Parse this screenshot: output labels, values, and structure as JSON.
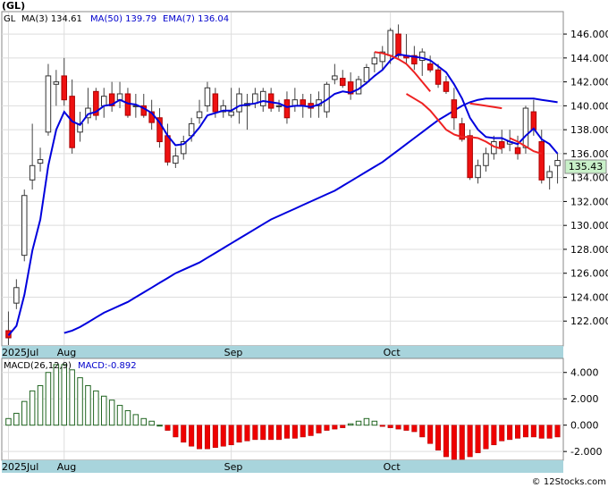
{
  "header": {
    "ticker": "(GL)",
    "credit": "© 12Stocks.com"
  },
  "legend": {
    "symbol": "GL",
    "items": [
      {
        "label": "MA(3)",
        "value": "134.61",
        "color": "#000000"
      },
      {
        "label": "MA(50)",
        "value": "139.79",
        "color": "#0000cc"
      },
      {
        "label": "EMA(7)",
        "value": "136.04",
        "color": "#0000cc"
      }
    ]
  },
  "macd_legend": {
    "params": "MACD(26,12,9)",
    "value": "MACD:-0.892"
  },
  "last_price_tag": "135.43",
  "colors": {
    "up": "#ffffff",
    "down": "#ee1111",
    "wick": "#444444",
    "ema": "#0000dd",
    "ma50": "#0000dd",
    "ma_red": "#ee2222",
    "macd_pos": "#226622",
    "macd_neg": "#ee0000",
    "axis_band": "#a8d4dc",
    "price_tag_bg": "#c8f0c8",
    "grid": "#dddddd"
  },
  "chart_data": [
    {
      "type": "candlestick",
      "y_ticks": [
        122,
        124,
        126,
        128,
        130,
        132,
        134,
        136,
        138,
        140,
        142,
        144,
        146
      ],
      "ylim": [
        120,
        147.8
      ],
      "x_labels": [
        {
          "index": 0,
          "text": "2025Jul"
        },
        {
          "index": 7,
          "text": "Aug"
        },
        {
          "index": 28,
          "text": "Sep"
        },
        {
          "index": 48,
          "text": "Oct"
        }
      ],
      "candles": [
        [
          121.2,
          122.8,
          120.0,
          120.6
        ],
        [
          123.5,
          125.5,
          123.0,
          124.8
        ],
        [
          127.5,
          133.0,
          127.0,
          132.5
        ],
        [
          133.8,
          138.5,
          133.0,
          135.0
        ],
        [
          135.2,
          136.5,
          134.5,
          135.5
        ],
        [
          137.8,
          143.5,
          137.5,
          142.5
        ],
        [
          141.8,
          143.0,
          140.0,
          142.0
        ],
        [
          142.5,
          144.0,
          140.0,
          140.5
        ],
        [
          140.8,
          142.2,
          136.0,
          136.5
        ],
        [
          137.8,
          139.5,
          137.0,
          138.5
        ],
        [
          139.0,
          141.5,
          138.5,
          139.8
        ],
        [
          141.2,
          141.5,
          138.8,
          139.2
        ],
        [
          140.0,
          141.5,
          139.0,
          140.8
        ],
        [
          141.0,
          142.0,
          139.5,
          140.0
        ],
        [
          140.5,
          142.0,
          139.8,
          141.0
        ],
        [
          141.0,
          141.5,
          139.0,
          139.2
        ],
        [
          140.0,
          141.0,
          139.0,
          140.0
        ],
        [
          140.0,
          141.0,
          139.0,
          139.2
        ],
        [
          139.5,
          140.5,
          138.0,
          138.6
        ],
        [
          139.0,
          139.8,
          136.5,
          137.0
        ],
        [
          137.5,
          138.5,
          135.0,
          135.3
        ],
        [
          135.2,
          136.5,
          134.8,
          135.8
        ],
        [
          136.0,
          137.5,
          135.5,
          137.0
        ],
        [
          137.5,
          139.0,
          137.0,
          138.5
        ],
        [
          139.0,
          140.5,
          138.5,
          139.5
        ],
        [
          140.0,
          142.0,
          139.5,
          141.5
        ],
        [
          141.0,
          141.5,
          139.0,
          139.5
        ],
        [
          139.5,
          140.5,
          139.0,
          140.0
        ],
        [
          139.2,
          141.5,
          139.0,
          139.5
        ],
        [
          139.5,
          141.5,
          138.5,
          141.0
        ],
        [
          140.0,
          141.0,
          138.0,
          140.2
        ],
        [
          140.2,
          141.5,
          139.8,
          141.0
        ],
        [
          140.0,
          141.5,
          139.5,
          141.2
        ],
        [
          141.0,
          141.5,
          139.5,
          139.8
        ],
        [
          140.0,
          140.5,
          139.5,
          140.0
        ],
        [
          140.5,
          141.2,
          138.5,
          139.0
        ],
        [
          140.0,
          141.5,
          139.5,
          140.5
        ],
        [
          140.5,
          141.0,
          139.0,
          140.0
        ],
        [
          140.2,
          141.0,
          139.0,
          139.8
        ],
        [
          140.0,
          141.2,
          139.0,
          140.5
        ],
        [
          139.5,
          142.0,
          139.0,
          141.8
        ],
        [
          142.2,
          143.5,
          141.8,
          142.5
        ],
        [
          142.3,
          143.0,
          141.5,
          141.7
        ],
        [
          142.0,
          142.8,
          140.5,
          141.0
        ],
        [
          141.0,
          142.5,
          141.0,
          142.2
        ],
        [
          142.0,
          143.5,
          141.8,
          143.2
        ],
        [
          143.5,
          144.5,
          142.8,
          144.0
        ],
        [
          143.7,
          145.0,
          143.0,
          144.5
        ],
        [
          144.2,
          146.5,
          143.5,
          146.3
        ],
        [
          146.0,
          146.8,
          144.0,
          144.2
        ],
        [
          144.2,
          146.0,
          143.5,
          144.0
        ],
        [
          144.2,
          145.0,
          143.0,
          143.5
        ],
        [
          143.8,
          144.8,
          142.5,
          144.5
        ],
        [
          143.5,
          144.2,
          142.8,
          143.0
        ],
        [
          143.0,
          143.5,
          141.5,
          141.8
        ],
        [
          142.0,
          142.5,
          141.0,
          141.2
        ],
        [
          140.5,
          141.5,
          138.0,
          139.0
        ],
        [
          138.5,
          139.0,
          137.0,
          137.2
        ],
        [
          137.5,
          138.0,
          133.8,
          134.0
        ],
        [
          134.0,
          135.5,
          133.5,
          135.0
        ],
        [
          135.0,
          136.5,
          134.5,
          136.0
        ],
        [
          136.0,
          137.5,
          135.5,
          137.0
        ],
        [
          137.0,
          138.0,
          136.0,
          136.5
        ],
        [
          136.8,
          138.0,
          136.2,
          137.0
        ],
        [
          136.5,
          137.5,
          135.5,
          136.0
        ],
        [
          136.5,
          140.0,
          136.0,
          139.8
        ],
        [
          139.5,
          140.5,
          137.5,
          138.0
        ],
        [
          137.0,
          138.0,
          133.5,
          133.8
        ],
        [
          134.0,
          135.0,
          133.0,
          134.5
        ],
        [
          135.0,
          136.0,
          133.5,
          135.43
        ]
      ],
      "series": [
        {
          "name": "MA(50)",
          "values": [
            121.0,
            121.2,
            121.5,
            121.9,
            122.3,
            122.7,
            123.0,
            123.3,
            123.6,
            124.0,
            124.4,
            124.8,
            125.2,
            125.6,
            126.0,
            126.3,
            126.6,
            126.9,
            127.3,
            127.7,
            128.1,
            128.5,
            128.9,
            129.3,
            129.7,
            130.1,
            130.5,
            130.8,
            131.1,
            131.4,
            131.7,
            132.0,
            132.3,
            132.6,
            132.9,
            133.3,
            133.7,
            134.1,
            134.5,
            134.9,
            135.3,
            135.8,
            136.3,
            136.8,
            137.3,
            137.8,
            138.3,
            138.8,
            139.2,
            139.6,
            140.0,
            140.3,
            140.5,
            140.6,
            140.6,
            140.6,
            140.6,
            140.6,
            140.6,
            140.6,
            140.5,
            140.4,
            140.3
          ]
        },
        {
          "name": "EMA(7)",
          "values": [
            120.8,
            121.6,
            124.2,
            127.9,
            130.5,
            135.0,
            138.0,
            139.5,
            138.7,
            138.4,
            139.3,
            139.5,
            140.0,
            140.1,
            140.5,
            140.2,
            140.1,
            139.8,
            139.4,
            138.6,
            137.5,
            136.7,
            136.8,
            137.4,
            138.2,
            139.2,
            139.4,
            139.6,
            139.6,
            140.0,
            140.1,
            140.2,
            140.4,
            140.3,
            140.2,
            139.9,
            140.0,
            140.0,
            139.9,
            140.1,
            140.5,
            141.0,
            141.2,
            141.1,
            141.4,
            141.9,
            142.5,
            143.0,
            143.8,
            144.3,
            144.2,
            144.1,
            144.0,
            143.8,
            143.3,
            142.8,
            141.8,
            140.6,
            139.0,
            138.0,
            137.4,
            137.3,
            137.3,
            137.0,
            136.8,
            137.5,
            138.1,
            137.2,
            136.8,
            136.0
          ]
        },
        {
          "name": "MA",
          "values": [
            140.2,
            140.1,
            140.0,
            139.9,
            139.8
          ]
        }
      ]
    },
    {
      "type": "bar",
      "name": "MACD(26,12,9)",
      "y_ticks": [
        4.0,
        2.0,
        0.0,
        -2.0
      ],
      "ylim": [
        -2.6,
        5.0
      ],
      "values": [
        0.5,
        0.9,
        1.8,
        2.6,
        3.0,
        4.0,
        4.6,
        4.6,
        4.2,
        3.6,
        3.0,
        2.6,
        2.2,
        1.9,
        1.5,
        1.1,
        0.8,
        0.5,
        0.3,
        0.0,
        -0.4,
        -0.9,
        -1.3,
        -1.6,
        -1.8,
        -1.8,
        -1.7,
        -1.6,
        -1.5,
        -1.3,
        -1.2,
        -1.1,
        -1.1,
        -1.1,
        -1.1,
        -1.0,
        -1.0,
        -0.9,
        -0.8,
        -0.6,
        -0.4,
        -0.3,
        -0.2,
        0.1,
        0.3,
        0.5,
        0.3,
        -0.1,
        -0.2,
        -0.3,
        -0.4,
        -0.5,
        -0.9,
        -1.4,
        -1.9,
        -2.4,
        -2.6,
        -2.6,
        -2.4,
        -2.1,
        -1.8,
        -1.5,
        -1.2,
        -1.1,
        -1.0,
        -0.9,
        -0.9,
        -1.0,
        -1.0,
        -0.9
      ]
    }
  ]
}
